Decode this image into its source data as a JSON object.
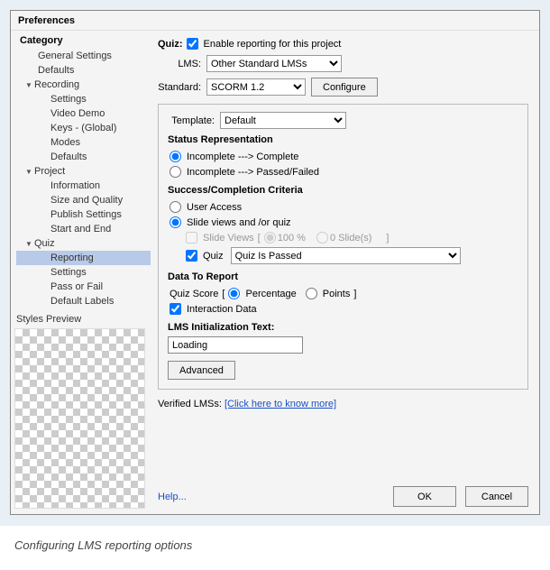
{
  "dialog": {
    "title": "Preferences"
  },
  "sidebar": {
    "heading": "Category",
    "items": [
      {
        "label": "General Settings",
        "type": "item"
      },
      {
        "label": "Defaults",
        "type": "item"
      },
      {
        "label": "Recording",
        "type": "group"
      },
      {
        "label": "Settings",
        "type": "sub"
      },
      {
        "label": "Video Demo",
        "type": "sub"
      },
      {
        "label": "Keys - (Global)",
        "type": "sub"
      },
      {
        "label": "Modes",
        "type": "sub"
      },
      {
        "label": "Defaults",
        "type": "sub"
      },
      {
        "label": "Project",
        "type": "group"
      },
      {
        "label": "Information",
        "type": "sub"
      },
      {
        "label": "Size and Quality",
        "type": "sub"
      },
      {
        "label": "Publish Settings",
        "type": "sub"
      },
      {
        "label": "Start and End",
        "type": "sub"
      },
      {
        "label": "Quiz",
        "type": "group"
      },
      {
        "label": "Reporting",
        "type": "sub",
        "selected": true
      },
      {
        "label": "Settings",
        "type": "sub"
      },
      {
        "label": "Pass or Fail",
        "type": "sub"
      },
      {
        "label": "Default Labels",
        "type": "sub"
      }
    ],
    "stylesPreviewLabel": "Styles Preview"
  },
  "quiz": {
    "heading": "Quiz:",
    "enableLabel": "Enable reporting for this project",
    "enableChecked": true,
    "lmsLabel": "LMS:",
    "lmsValue": "Other Standard LMSs",
    "standardLabel": "Standard:",
    "standardValue": "SCORM 1.2",
    "configureLabel": "Configure",
    "templateLabel": "Template:",
    "templateValue": "Default",
    "statusHead": "Status Representation",
    "status1": "Incomplete ---> Complete",
    "status2": "Incomplete ---> Passed/Failed",
    "statusSel": 0,
    "criteriaHead": "Success/Completion Criteria",
    "crit1": "User Access",
    "crit2": "Slide views and /or quiz",
    "critSel": 1,
    "slideViewsLabel": "Slide Views",
    "slideViewsPct": "100 %",
    "slideViewsCount": "0 Slide(s)",
    "quizCheckLabel": "Quiz",
    "quizCheckChecked": true,
    "quizCriteriaValue": "Quiz Is Passed",
    "dataHead": "Data To Report",
    "quizScoreLabel": "Quiz Score",
    "scorePct": "Percentage",
    "scorePts": "Points",
    "scoreSel": 0,
    "interactionLabel": "Interaction Data",
    "interactionChecked": true,
    "initHead": "LMS Initialization Text:",
    "initValue": "Loading",
    "advancedLabel": "Advanced",
    "verifiedPrefix": "Verified LMSs: ",
    "verifiedLink": "[Click here to know more]"
  },
  "footer": {
    "help": "Help...",
    "ok": "OK",
    "cancel": "Cancel"
  },
  "caption": "Configuring LMS reporting options"
}
